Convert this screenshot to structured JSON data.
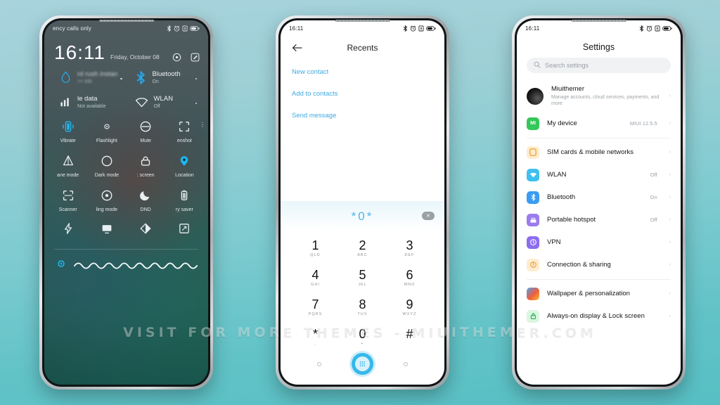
{
  "background": {
    "top_color": "#a8d3dd",
    "bottom_color": "#57bfc4"
  },
  "watermark": {
    "text": "VISIT  FOR  MORE  THEMES   -   MIUITHEMER.COM"
  },
  "phone1": {
    "status": {
      "carrier": "ency calls only",
      "icons": [
        "bluetooth-icon",
        "alarm-icon",
        "sim-icon",
        "battery-icon"
      ]
    },
    "lock": {
      "time": "16:11",
      "date": "Friday, October 08",
      "icon_settings": "settings-gear-icon",
      "icon_edit": "edit-icon"
    },
    "big_tiles": [
      {
        "title": "rd rush instan",
        "sub": "== MB",
        "icon": "water-drop-icon",
        "accent": "#2aa8e8",
        "blurred": true
      },
      {
        "title": "Bluetooth",
        "sub": "On",
        "icon": "bluetooth-icon",
        "accent": "#2aa8e8",
        "blurred": false
      },
      {
        "title": "le data",
        "sub": "Not available",
        "icon": "signal-bars-icon",
        "accent": "#ffffff",
        "blurred": false
      },
      {
        "title": "WLAN",
        "sub": "Off",
        "icon": "wifi-icon",
        "accent": "#ffffff",
        "blurred": false
      }
    ],
    "toggles_row1": [
      {
        "label": "Vibrate",
        "icon": "vibrate-icon",
        "on": true
      },
      {
        "label": "Flashlight",
        "icon": "flashlight-icon",
        "on": false
      },
      {
        "label": "Mute",
        "icon": "mute-icon",
        "on": false
      },
      {
        "label": "enshot",
        "icon": "screenshot-icon",
        "on": false
      }
    ],
    "toggles_row2": [
      {
        "label": "ane mode",
        "icon": "airplane-icon",
        "on": false
      },
      {
        "label": "Dark mode",
        "icon": "dark-mode-icon",
        "on": false
      },
      {
        "label": ": screen",
        "icon": "lock-screen-icon",
        "on": false
      },
      {
        "label": "Location",
        "icon": "location-icon",
        "on": true
      }
    ],
    "toggles_row3": [
      {
        "label": "Scanner",
        "icon": "scanner-icon",
        "on": false
      },
      {
        "label": "ling mode",
        "icon": "reading-mode-icon",
        "on": false
      },
      {
        "label": "DND",
        "icon": "dnd-moon-icon",
        "on": false
      },
      {
        "label": "ry saver",
        "icon": "battery-saver-icon",
        "on": false
      }
    ],
    "toggles_row4": [
      {
        "label": "",
        "icon": "lightning-icon",
        "on": false
      },
      {
        "label": "",
        "icon": "cast-icon",
        "on": false
      },
      {
        "label": "",
        "icon": "contrast-icon",
        "on": false
      },
      {
        "label": "",
        "icon": "resize-icon",
        "on": false
      }
    ],
    "brightness": {
      "icon": "brightness-icon",
      "slider": "wave-slider",
      "accent": "#2aa8e8"
    }
  },
  "phone2": {
    "status": {
      "time": "16:11",
      "icons": [
        "bluetooth-icon",
        "alarm-icon",
        "sim-icon",
        "battery-icon"
      ]
    },
    "header": {
      "back_icon": "back-arrow-icon",
      "title": "Recents"
    },
    "actions": [
      {
        "label": "New contact"
      },
      {
        "label": "Add to contacts"
      },
      {
        "label": "Send message"
      }
    ],
    "number_display": {
      "value": "*0*",
      "delete_icon": "backspace-icon"
    },
    "keys": [
      {
        "digit": "1",
        "sub": "QLD"
      },
      {
        "digit": "2",
        "sub": "ABC"
      },
      {
        "digit": "3",
        "sub": "DEF"
      },
      {
        "digit": "4",
        "sub": "GHI"
      },
      {
        "digit": "5",
        "sub": "JKL"
      },
      {
        "digit": "6",
        "sub": "MNO"
      },
      {
        "digit": "7",
        "sub": "PQRS"
      },
      {
        "digit": "8",
        "sub": "TUV"
      },
      {
        "digit": "9",
        "sub": "WXYZ"
      },
      {
        "digit": "*",
        "sub": ","
      },
      {
        "digit": "0",
        "sub": "+"
      },
      {
        "digit": "#",
        "sub": ""
      }
    ],
    "bottom": {
      "left_icon": "nav-dot-icon",
      "call_icon": "dialpad-call-icon",
      "right_icon": "nav-dot-icon",
      "accent": "#35b8ea"
    }
  },
  "phone3": {
    "status": {
      "time": "16:11",
      "icons": [
        "bluetooth-icon",
        "alarm-icon",
        "sim-icon",
        "battery-icon"
      ]
    },
    "title": "Settings",
    "search": {
      "placeholder": "Search settings",
      "icon": "search-icon"
    },
    "account": {
      "name": "Miuithemer",
      "desc": "Manage accounts, cloud services, payments, and more",
      "icon": "avatar-icon"
    },
    "device": {
      "name": "My device",
      "value": "MIUI 12.5.5",
      "icon": "mi-logo-icon",
      "color": "#34c759"
    },
    "items": [
      {
        "name": "SIM cards & mobile networks",
        "value": "",
        "icon": "sim-card-icon",
        "color": "#f4a62a"
      },
      {
        "name": "WLAN",
        "value": "Off",
        "icon": "wifi-icon",
        "color": "#3fc0f0"
      },
      {
        "name": "Bluetooth",
        "value": "On",
        "icon": "bluetooth-icon",
        "color": "#3b9bf0"
      },
      {
        "name": "Portable hotspot",
        "value": "Off",
        "icon": "hotspot-icon",
        "color": "#9b7bf0"
      },
      {
        "name": "VPN",
        "value": "",
        "icon": "vpn-icon",
        "color": "#8c6df0"
      },
      {
        "name": "Connection & sharing",
        "value": "",
        "icon": "connection-sharing-icon",
        "color": "#f4a62a"
      }
    ],
    "items2": [
      {
        "name": "Wallpaper & personalization",
        "value": "",
        "icon": "wallpaper-icon",
        "color": "#ef5b3c"
      },
      {
        "name": "Always-on display & Lock screen",
        "value": "",
        "icon": "lock-icon",
        "color": "#34c759"
      }
    ]
  }
}
